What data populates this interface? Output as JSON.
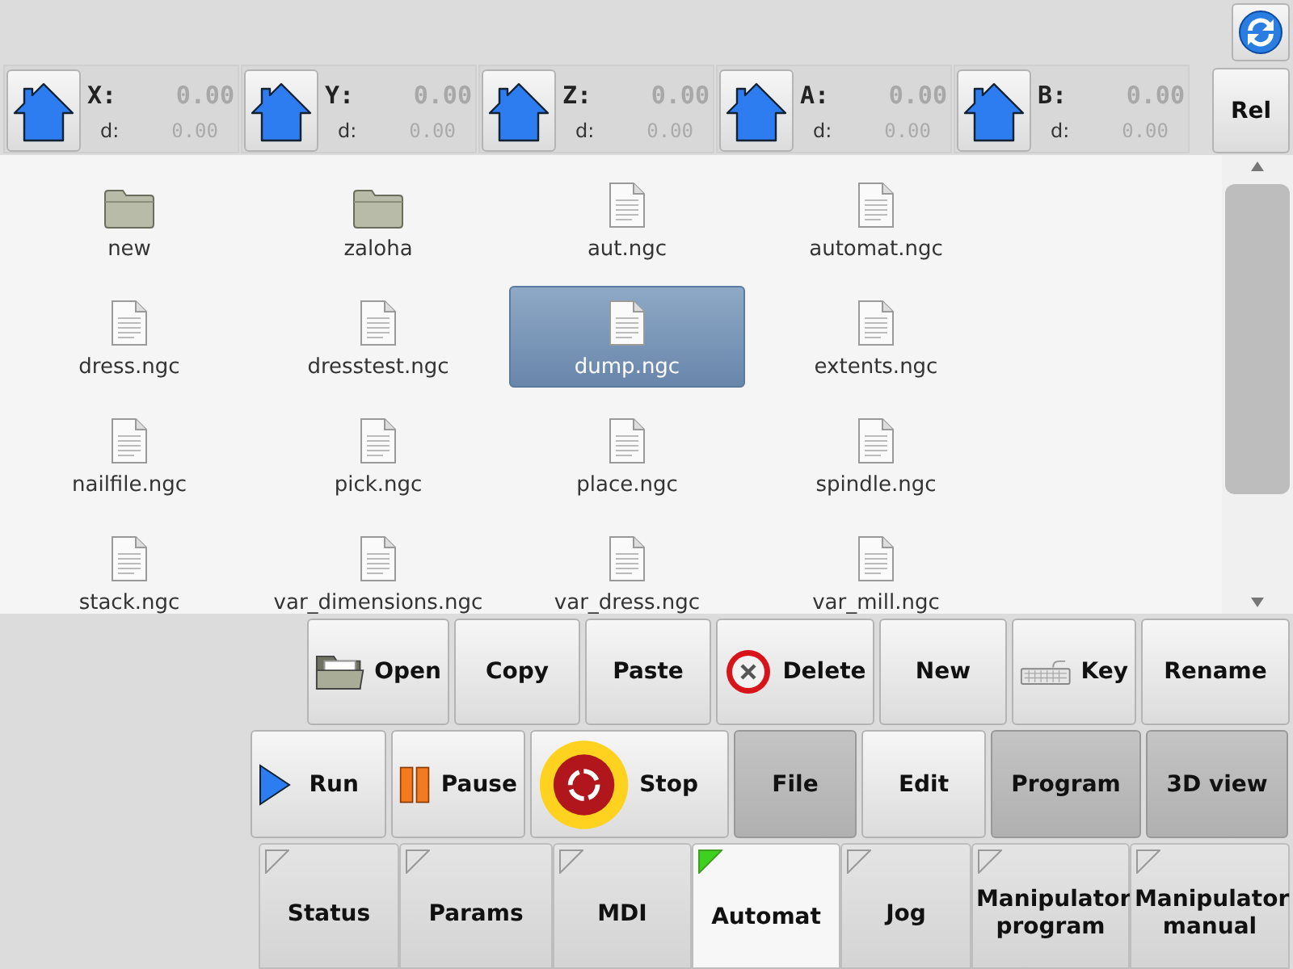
{
  "axes": [
    {
      "label": "X:",
      "value": "0.00",
      "d_label": "d:",
      "d_value": "0.00"
    },
    {
      "label": "Y:",
      "value": "0.00",
      "d_label": "d:",
      "d_value": "0.00"
    },
    {
      "label": "Z:",
      "value": "0.00",
      "d_label": "d:",
      "d_value": "0.00"
    },
    {
      "label": "A:",
      "value": "0.00",
      "d_label": "d:",
      "d_value": "0.00"
    },
    {
      "label": "B:",
      "value": "0.00",
      "d_label": "d:",
      "d_value": "0.00"
    }
  ],
  "rel_button": {
    "label": "Rel"
  },
  "files": [
    {
      "name": "new",
      "kind": "folder",
      "selected": false
    },
    {
      "name": "zaloha",
      "kind": "folder",
      "selected": false
    },
    {
      "name": "aut.ngc",
      "kind": "file",
      "selected": false
    },
    {
      "name": "automat.ngc",
      "kind": "file",
      "selected": false
    },
    {
      "name": "dress.ngc",
      "kind": "file",
      "selected": false
    },
    {
      "name": "dresstest.ngc",
      "kind": "file",
      "selected": false
    },
    {
      "name": "dump.ngc",
      "kind": "file",
      "selected": true
    },
    {
      "name": "extents.ngc",
      "kind": "file",
      "selected": false
    },
    {
      "name": "nailfile.ngc",
      "kind": "file",
      "selected": false
    },
    {
      "name": "pick.ngc",
      "kind": "file",
      "selected": false
    },
    {
      "name": "place.ngc",
      "kind": "file",
      "selected": false
    },
    {
      "name": "spindle.ngc",
      "kind": "file",
      "selected": false
    },
    {
      "name": "stack.ngc",
      "kind": "file",
      "selected": false
    },
    {
      "name": "var_dimensions.ngc",
      "kind": "file",
      "selected": false
    },
    {
      "name": "var_dress.ngc",
      "kind": "file",
      "selected": false
    },
    {
      "name": "var_mill.ngc",
      "kind": "file",
      "selected": false
    }
  ],
  "file_buttons": [
    {
      "label": "Open"
    },
    {
      "label": "Copy"
    },
    {
      "label": "Paste"
    },
    {
      "label": "Delete"
    },
    {
      "label": "New"
    },
    {
      "label": "Key"
    },
    {
      "label": "Rename"
    }
  ],
  "control_buttons": [
    {
      "label": "Run",
      "pressed": false
    },
    {
      "label": "Pause",
      "pressed": false
    },
    {
      "label": "Stop",
      "pressed": false
    },
    {
      "label": "File",
      "pressed": true
    },
    {
      "label": "Edit",
      "pressed": false
    },
    {
      "label": "Program",
      "pressed": true
    },
    {
      "label": "3D view",
      "pressed": true
    }
  ],
  "tabs": [
    {
      "label": "Status",
      "selected": false
    },
    {
      "label": "Params",
      "selected": false
    },
    {
      "label": "MDI",
      "selected": false
    },
    {
      "label": "Automat",
      "selected": true
    },
    {
      "label": "Jog",
      "selected": false
    },
    {
      "label": "Manipulator program",
      "selected": false
    },
    {
      "label": "Manipulator manual",
      "selected": false
    }
  ]
}
